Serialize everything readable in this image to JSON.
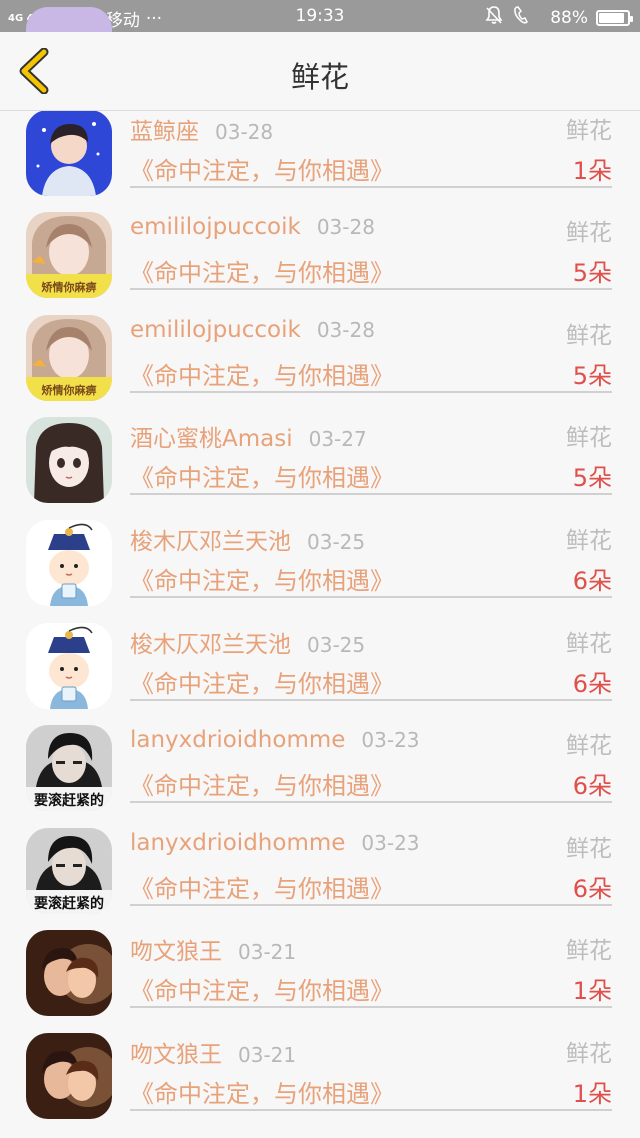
{
  "status_bar": {
    "network": "4G 4G",
    "carrier": "中国移动",
    "dots": "···",
    "time": "19:33",
    "icons": [
      "bell-off-icon",
      "hd-call-icon"
    ],
    "hd": "HD",
    "battery_text": "88%",
    "battery_level": 0.88
  },
  "header": {
    "title": "鲜花",
    "back_icon": "chevron-left-icon",
    "back_color": "#f5c400"
  },
  "colors": {
    "name": "#e8a27a",
    "count": "#e0504a",
    "muted": "#bdbdbd"
  },
  "rows": [
    {
      "name": "",
      "date": "",
      "gift": "",
      "title": "《命中注定，与你相遇》",
      "count": "1朵",
      "avatar": "purple-girl"
    },
    {
      "name": "蓝鲸座",
      "date": "03-28",
      "gift": "鲜花",
      "title": "《命中注定，与你相遇》",
      "count": "1朵",
      "avatar": "blue-boy"
    },
    {
      "name": "emililojpuccoik",
      "date": "03-28",
      "gift": "鲜花",
      "title": "《命中注定，与你相遇》",
      "count": "5朵",
      "avatar": "pink-girl",
      "avatar_text": "矫情你麻痹"
    },
    {
      "name": "emililojpuccoik",
      "date": "03-28",
      "gift": "鲜花",
      "title": "《命中注定，与你相遇》",
      "count": "5朵",
      "avatar": "pink-girl",
      "avatar_text": "矫情你麻痹"
    },
    {
      "name": "酒心蜜桃Amasi",
      "date": "03-27",
      "gift": "鲜花",
      "title": "《命中注定，与你相遇》",
      "count": "5朵",
      "avatar": "anime-girl"
    },
    {
      "name": "梭木仄邓兰天池",
      "date": "03-25",
      "gift": "鲜花",
      "title": "《命中注定，与你相遇》",
      "count": "6朵",
      "avatar": "cartoon-qing"
    },
    {
      "name": "梭木仄邓兰天池",
      "date": "03-25",
      "gift": "鲜花",
      "title": "《命中注定，与你相遇》",
      "count": "6朵",
      "avatar": "cartoon-qing"
    },
    {
      "name": "lanyxdrioidhomme",
      "date": "03-23",
      "gift": "鲜花",
      "title": "《命中注定，与你相遇》",
      "count": "6朵",
      "avatar": "dark-boy",
      "avatar_text": "要滚赶紧的"
    },
    {
      "name": "lanyxdrioidhomme",
      "date": "03-23",
      "gift": "鲜花",
      "title": "《命中注定，与你相遇》",
      "count": "6朵",
      "avatar": "dark-boy",
      "avatar_text": "要滚赶紧的"
    },
    {
      "name": "吻文狼王",
      "date": "03-21",
      "gift": "鲜花",
      "title": "《命中注定，与你相遇》",
      "count": "1朵",
      "avatar": "couple"
    },
    {
      "name": "吻文狼王",
      "date": "03-21",
      "gift": "鲜花",
      "title": "《命中注定，与你相遇》",
      "count": "1朵",
      "avatar": "couple"
    }
  ]
}
